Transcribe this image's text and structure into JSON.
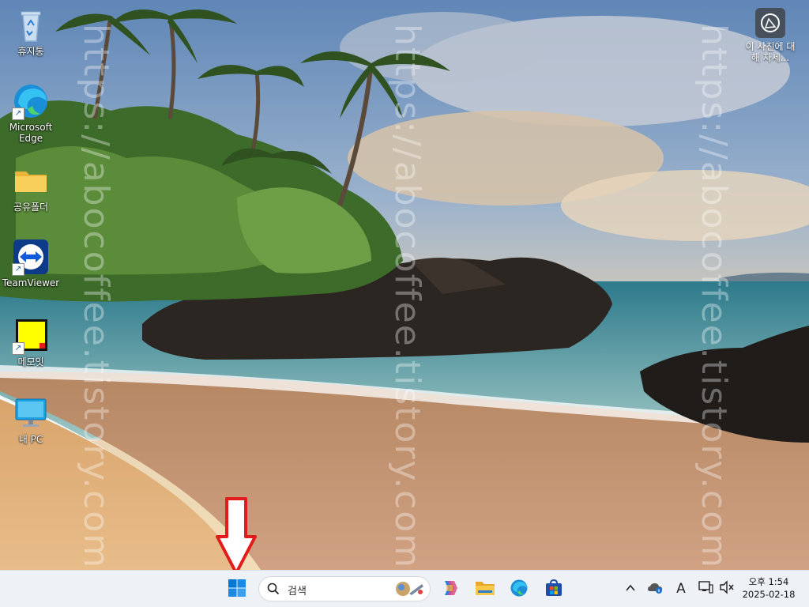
{
  "desktop": {
    "icons": [
      {
        "label": "휴지통",
        "icon": "recycle-bin-icon"
      },
      {
        "label": "Microsoft Edge",
        "icon": "edge-icon"
      },
      {
        "label": "공유폴더",
        "icon": "folder-icon"
      },
      {
        "label": "TeamViewer",
        "icon": "teamviewer-icon"
      },
      {
        "label": "메모잇",
        "icon": "sticky-note-icon"
      },
      {
        "label": "내 PC",
        "icon": "monitor-icon"
      }
    ],
    "about_photo": {
      "label": "이 사진에 대해 자세..."
    },
    "watermark": "https://abocoffee.tistory.com"
  },
  "taskbar": {
    "search": {
      "placeholder": "검색"
    },
    "apps": [
      "windows-start-icon",
      "copilot-icon",
      "file-explorer-icon",
      "edge-icon",
      "microsoft-store-icon"
    ],
    "tray": {
      "ime": "A",
      "time": "오후 1:54",
      "date": "2025-02-18"
    }
  },
  "colors": {
    "taskbar_bg": "#eef1f6",
    "arrow_red": "#e31b1b",
    "accent_blue": "#0067c0"
  }
}
